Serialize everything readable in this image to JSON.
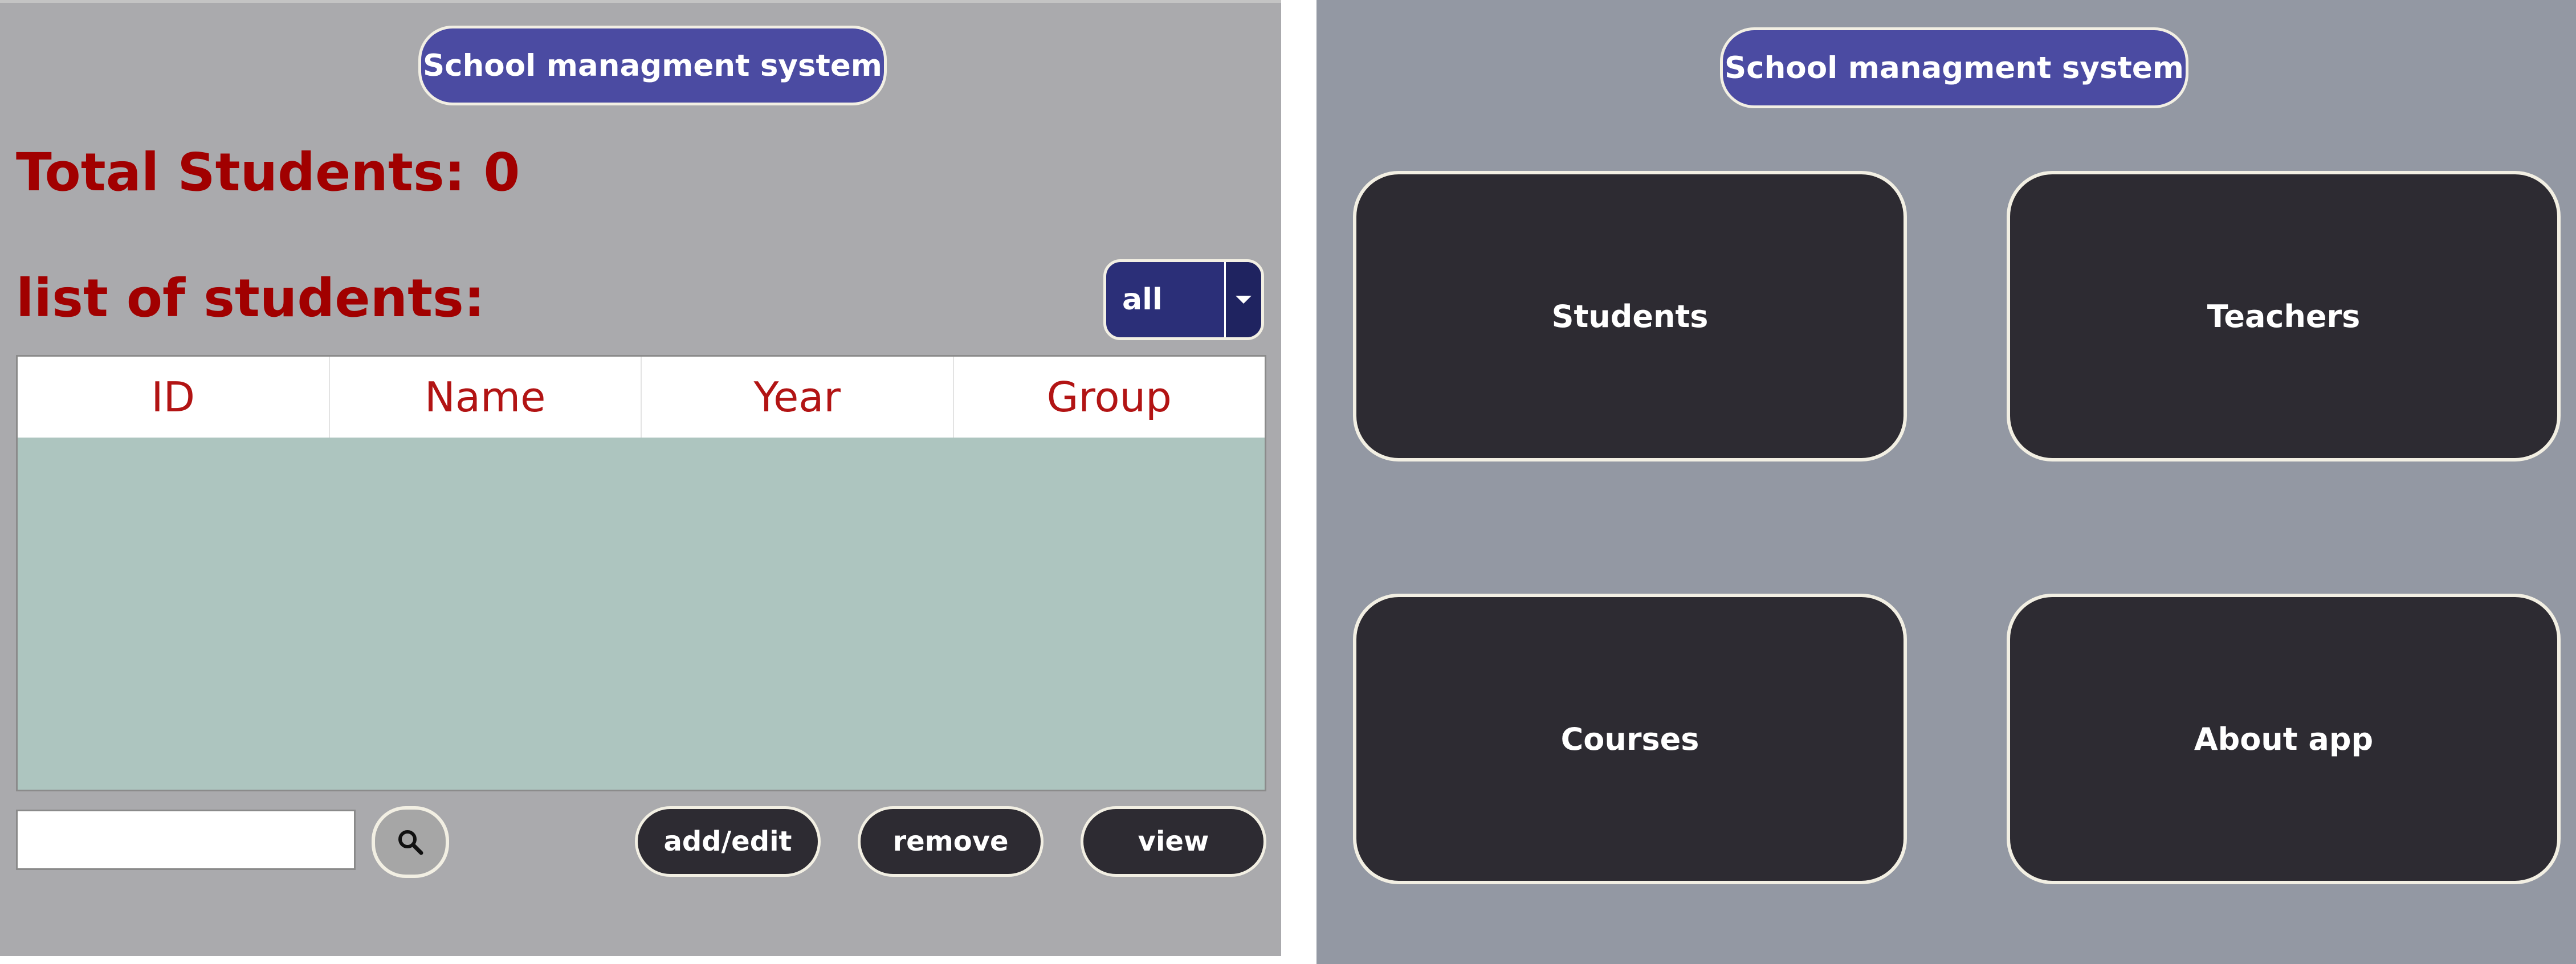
{
  "left": {
    "title": "School managment system",
    "total_students": "Total Students: 0",
    "list_heading": "list of students:",
    "filter": {
      "selected": "all"
    },
    "table": {
      "columns": [
        "ID",
        "Name",
        "Year",
        "Group"
      ],
      "rows": []
    },
    "search": {
      "value": "",
      "placeholder": ""
    },
    "buttons": {
      "add_edit": "add/edit",
      "remove": "remove",
      "view": "view"
    }
  },
  "right": {
    "title": "School managment system",
    "tiles": {
      "students": "Students",
      "teachers": "Teachers",
      "courses": "Courses",
      "about": "About app"
    }
  },
  "colors": {
    "left_background": "#aaaaad",
    "right_background": "#9398a3",
    "title_pill": "#4b4ba2",
    "heading_red": "#a10000",
    "tile_dark": "#2d2b32",
    "table_body": "#adc5bf",
    "filter_select": "#2b2f78"
  },
  "icons": {
    "search": "search-icon",
    "dropdown": "chevron-down-icon"
  }
}
